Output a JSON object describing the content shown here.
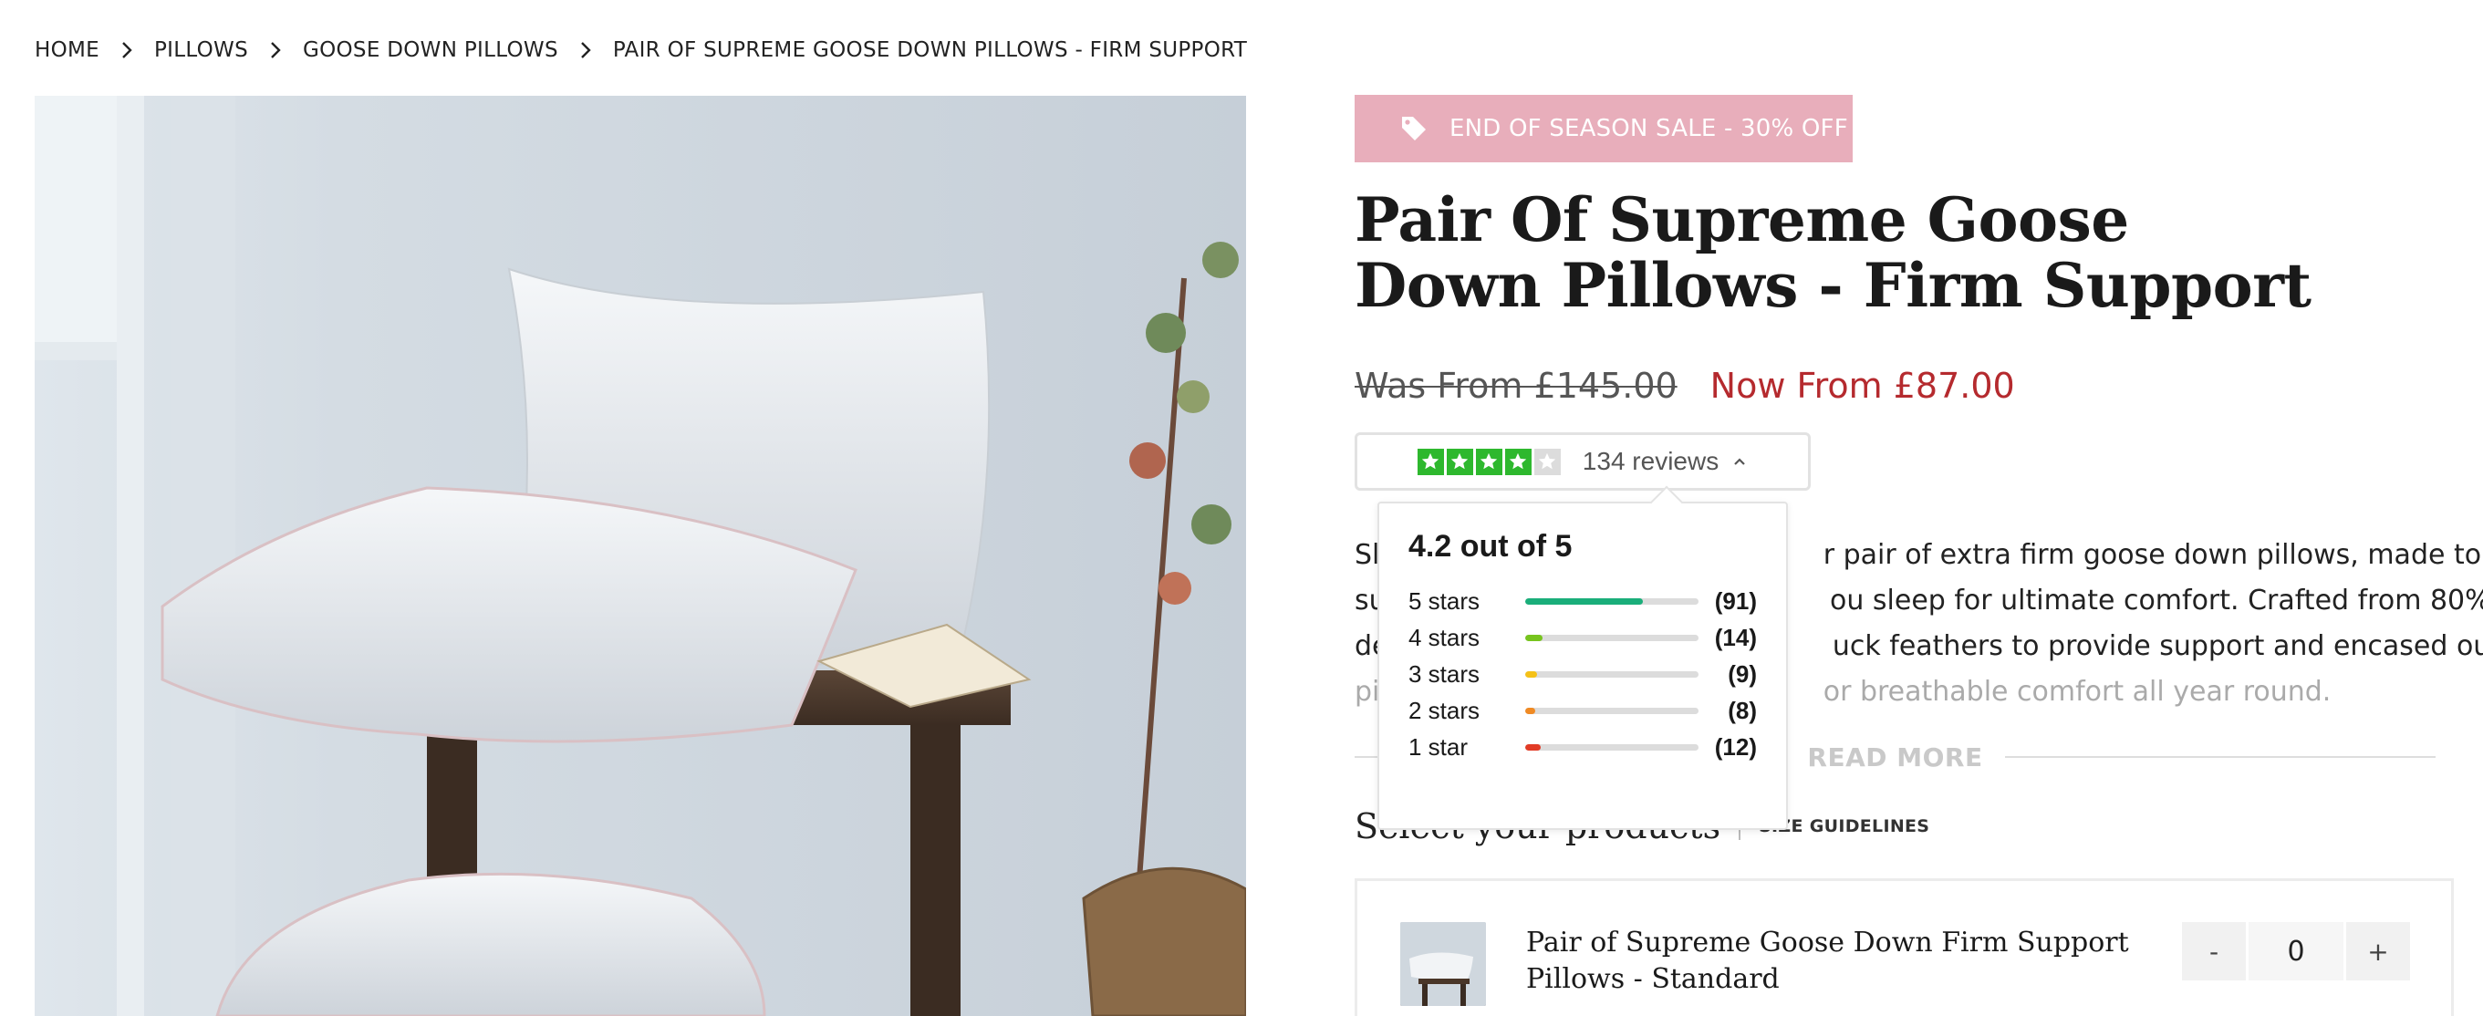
{
  "breadcrumb": {
    "items": [
      "HOME",
      "PILLOWS",
      "GOOSE DOWN PILLOWS",
      "PAIR OF SUPREME GOOSE DOWN PILLOWS - FIRM SUPPORT"
    ]
  },
  "product": {
    "sale_banner": "END OF SEASON SALE - 30% OFF",
    "title": "Pair Of Supreme Goose Down Pillows - Firm Support",
    "price_was": "Was From £145.00",
    "price_now": "Now From £87.00",
    "reviews": {
      "count_label": "134 reviews",
      "stars_filled": 4,
      "stars_total": 5
    },
    "description_lines": [
      "Sl                                                   r pair of extra firm goose down pillows, made to",
      "su                                                   ou sleep for ultimate comfort. Crafted from 80%",
      "de                                                   uck feathers to provide support and encased our",
      "pi                                                   or breathable comfort all year round."
    ],
    "read_more": "READ MORE"
  },
  "selection": {
    "title": "Select your products",
    "size_guide": "SIZE GUIDELINES",
    "item_name": "Pair of Supreme Goose Down Firm Support Pillows - Standard",
    "qty_minus": "-",
    "qty_value": "0",
    "qty_plus": "+"
  },
  "rating_popover": {
    "title": "4.2 out of 5",
    "rows": [
      {
        "label": "5 stars",
        "count": "(91)",
        "fraction": 0.68,
        "color": "#1aae7a"
      },
      {
        "label": "4 stars",
        "count": "(14)",
        "fraction": 0.1,
        "color": "#77c41e"
      },
      {
        "label": "3 stars",
        "count": "(9)",
        "fraction": 0.07,
        "color": "#f5c117"
      },
      {
        "label": "2 stars",
        "count": "(8)",
        "fraction": 0.06,
        "color": "#f08a23"
      },
      {
        "label": "1 star",
        "count": "(12)",
        "fraction": 0.09,
        "color": "#e23b26"
      }
    ]
  },
  "colors": {
    "sale_banner_bg": "#e8aebb",
    "price_now": "#b52a2e",
    "star_green": "#2eb82e"
  }
}
